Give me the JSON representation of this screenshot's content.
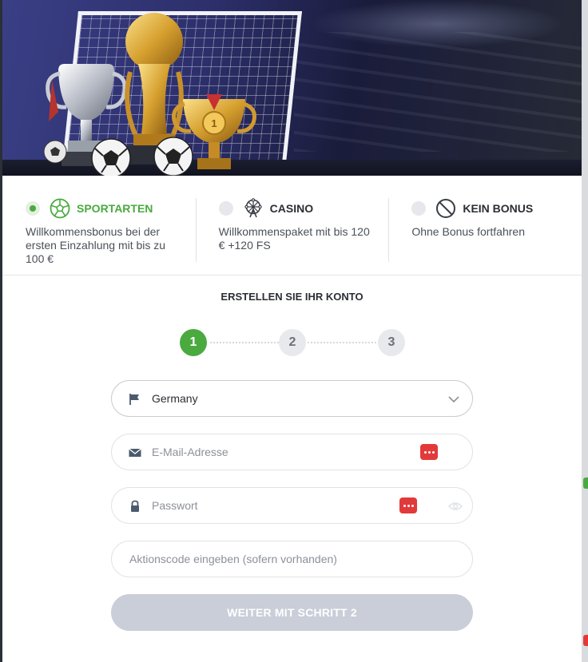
{
  "bonus_options": [
    {
      "title": "SPORTARTEN",
      "description": "Willkommensbonus bei der ersten Einzahlung mit bis zu 100 €",
      "selected": true,
      "icon": "soccer-ball-icon"
    },
    {
      "title": "CASINO",
      "description": "Willkommenspaket mit bis 120 € +120 FS",
      "selected": false,
      "icon": "ferris-wheel-icon"
    },
    {
      "title": "KEIN BONUS",
      "description": "Ohne Bonus fortfahren",
      "selected": false,
      "icon": "no-symbol-icon"
    }
  ],
  "form": {
    "title": "ERSTELLEN SIE IHR KONTO",
    "steps": [
      "1",
      "2",
      "3"
    ],
    "active_step": 1,
    "country": {
      "value": "Germany",
      "icon": "flag-icon"
    },
    "email": {
      "placeholder": "E-Mail-Adresse",
      "icon": "envelope-icon"
    },
    "password": {
      "placeholder": "Passwort",
      "icon": "lock-icon"
    },
    "promo": {
      "placeholder": "Aktionscode eingeben (sofern vorhanden)"
    },
    "submit_label": "WEITER MIT SCHRITT 2"
  },
  "colors": {
    "accent": "#4aaa3f",
    "button_disabled": "#c9ced8",
    "password_manager_badge": "#e23a3a"
  }
}
